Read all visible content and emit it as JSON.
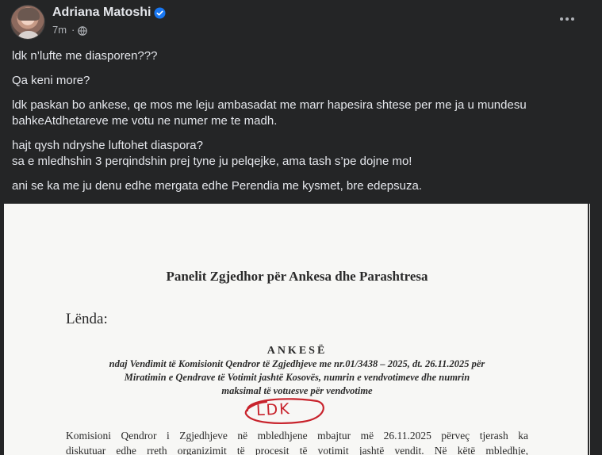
{
  "post": {
    "author": "Adriana Matoshi",
    "time": "7m",
    "separator": "·",
    "paragraphs": [
      "ldk n’lufte me diasporen???",
      "Qa keni more?",
      "ldk paskan bo ankese, qe mos me leju ambasadat me marr hapesira shtese per me ja u mundesu bahkeAtdhetareve me votu ne numer me te madh.",
      "hajt qysh ndryshe luftohet diaspora? sa e mledhshin 3 perqindshin prej tyne ju pelqejke, ama tash s’pe dojne mo!",
      "ani se ka me ju denu edhe mergata edhe Perendia me kysmet, bre edepsuza."
    ],
    "paragraph_lines": [
      [
        "ldk n’lufte me diasporen???"
      ],
      [
        "Qa keni more?"
      ],
      [
        "ldk paskan bo ankese, qe mos me leju ambasadat me marr hapesira shtese per me ja u mundesu",
        "bahkeAtdhetareve me votu ne numer me te madh."
      ],
      [
        "hajt qysh ndryshe luftohet diaspora?",
        "sa e mledhshin 3 perqindshin prej tyne ju pelqejke, ama tash s’pe dojne mo!"
      ],
      [
        "ani se ka me ju denu edhe mergata edhe Perendia me kysmet, bre edepsuza."
      ]
    ]
  },
  "icons": {
    "verified": "verified-badge-icon",
    "privacy": "globe-icon",
    "more": "more-options-icon"
  },
  "colors": {
    "background": "#242526",
    "text": "#e4e6eb",
    "secondary_text": "#b0b3b8",
    "verified_blue": "#1877f2",
    "stamp_red": "#c8232c"
  },
  "document": {
    "title": "Panelit Zgjedhor për Ankesa dhe Parashtresa",
    "subject_label": "Lënda:",
    "heading": "ANKESË",
    "subtitle_lines": [
      "ndaj Vendimit të Komisionit Qendror të Zgjedhjeve me nr.01/3438 – 2025, dt. 26.11.2025 për",
      "Miratimin e Qendrave të Votimit jashtë Kosovës, numrin e vendvotimeve dhe numrin",
      "maksimal të votuesve për vendvotime"
    ],
    "stamp_text": "LDK",
    "body_lines": [
      "Komisioni Qendror i Zgjedhjeve në mbledhjene mbajtur më 26.11.2025 përveç tjerash ka",
      "diskutuar edhe rreth organizimit të procesit të votimit jashtë vendit. Në këtë mbledhje,"
    ]
  }
}
